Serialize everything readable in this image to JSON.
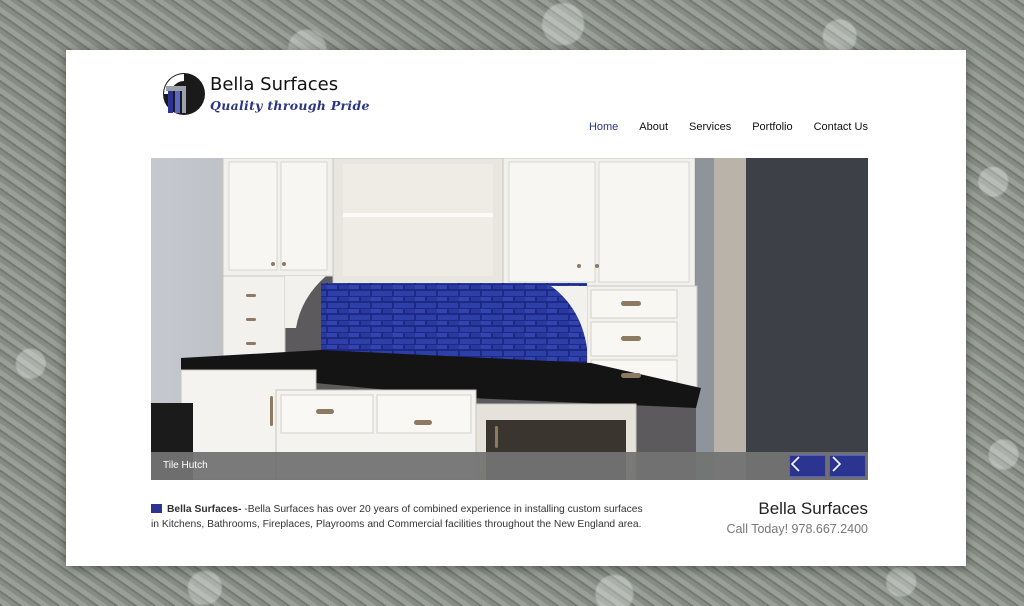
{
  "brand": {
    "name": "Bella Surfaces",
    "tagline": "Quality through Pride",
    "accent": "#2b3490"
  },
  "nav": {
    "items": [
      {
        "label": "Home",
        "active": true
      },
      {
        "label": "About",
        "active": false
      },
      {
        "label": "Services",
        "active": false
      },
      {
        "label": "Portfolio",
        "active": false
      },
      {
        "label": "Contact Us",
        "active": false
      }
    ]
  },
  "slider": {
    "caption": "Tile Hutch",
    "prev_icon": "chevron-left-icon",
    "next_icon": "chevron-right-icon"
  },
  "intro": {
    "lead": "Bella Surfaces-",
    "text": " -Bella Surfaces has over 20 years of combined experience in installing custom surfaces in Kitchens, Bathrooms, Fireplaces, Playrooms and Commercial facilities throughout the New England area."
  },
  "contact": {
    "name": "Bella Surfaces",
    "phone": "Call Today! 978.667.2400"
  }
}
